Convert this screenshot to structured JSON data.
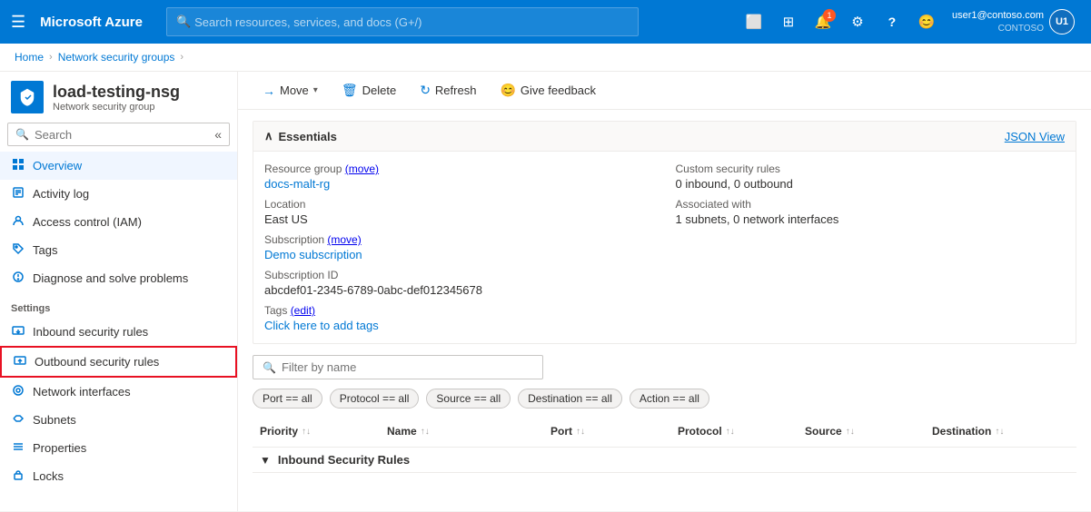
{
  "topbar": {
    "hamburger_icon": "☰",
    "logo": "Microsoft Azure",
    "search_placeholder": "Search resources, services, and docs (G+/)",
    "icons": [
      {
        "name": "cloud-shell-icon",
        "symbol": "⬛",
        "badge": null
      },
      {
        "name": "portal-menu-icon",
        "symbol": "⊞",
        "badge": null
      },
      {
        "name": "notifications-icon",
        "symbol": "🔔",
        "badge": "1"
      },
      {
        "name": "settings-icon",
        "symbol": "⚙",
        "badge": null
      },
      {
        "name": "help-icon",
        "symbol": "?",
        "badge": null
      },
      {
        "name": "feedback-icon",
        "symbol": "😊",
        "badge": null
      }
    ],
    "user": {
      "email": "user1@contoso.com",
      "tenant": "CONTOSO",
      "initials": "U1"
    }
  },
  "breadcrumb": {
    "items": [
      "Home",
      "Network security groups"
    ],
    "current": ""
  },
  "sidebar": {
    "search_placeholder": "Search",
    "resource": {
      "name": "load-testing-nsg",
      "type": "Network security group"
    },
    "nav_items": [
      {
        "id": "overview",
        "label": "Overview",
        "icon": "⊡",
        "active": true
      },
      {
        "id": "activity-log",
        "label": "Activity log",
        "icon": "📋",
        "active": false
      },
      {
        "id": "access-control",
        "label": "Access control (IAM)",
        "icon": "👤",
        "active": false
      },
      {
        "id": "tags",
        "label": "Tags",
        "icon": "🏷",
        "active": false
      },
      {
        "id": "diagnose",
        "label": "Diagnose and solve problems",
        "icon": "🔧",
        "active": false
      }
    ],
    "settings_label": "Settings",
    "settings_items": [
      {
        "id": "inbound-rules",
        "label": "Inbound security rules",
        "icon": "⬇",
        "active": false,
        "outline": false
      },
      {
        "id": "outbound-rules",
        "label": "Outbound security rules",
        "icon": "⬆",
        "active": false,
        "outline": true
      },
      {
        "id": "network-interfaces",
        "label": "Network interfaces",
        "icon": "🌐",
        "active": false,
        "outline": false
      },
      {
        "id": "subnets",
        "label": "Subnets",
        "icon": "◇",
        "active": false
      },
      {
        "id": "properties",
        "label": "Properties",
        "icon": "☰",
        "active": false
      },
      {
        "id": "locks",
        "label": "Locks",
        "icon": "🔒",
        "active": false
      }
    ]
  },
  "toolbar": {
    "move_label": "Move",
    "delete_label": "Delete",
    "refresh_label": "Refresh",
    "feedback_label": "Give feedback"
  },
  "essentials": {
    "title": "Essentials",
    "json_view_label": "JSON View",
    "fields_left": [
      {
        "label": "Resource group",
        "value": "docs-malt-rg",
        "link": true,
        "extra": "(move)"
      },
      {
        "label": "Location",
        "value": "East US"
      },
      {
        "label": "Subscription",
        "value": "Demo subscription",
        "link": true,
        "extra": "(move)"
      },
      {
        "label": "Subscription ID",
        "value": "abcdef01-2345-6789-0abc-def012345678"
      },
      {
        "label": "Tags",
        "value": "Click here to add tags",
        "link": true,
        "extra": "(edit)"
      }
    ],
    "fields_right": [
      {
        "label": "Custom security rules",
        "value": "0 inbound, 0 outbound"
      },
      {
        "label": "Associated with",
        "value": "1 subnets, 0 network interfaces"
      }
    ]
  },
  "filter": {
    "placeholder": "Filter by name",
    "tags": [
      "Port == all",
      "Protocol == all",
      "Source == all",
      "Destination == all",
      "Action == all"
    ]
  },
  "table": {
    "columns": [
      "Priority",
      "Name",
      "Port",
      "Protocol",
      "Source",
      "Destination"
    ],
    "group_label": "Inbound Security Rules",
    "group_collapse_icon": "▼"
  }
}
